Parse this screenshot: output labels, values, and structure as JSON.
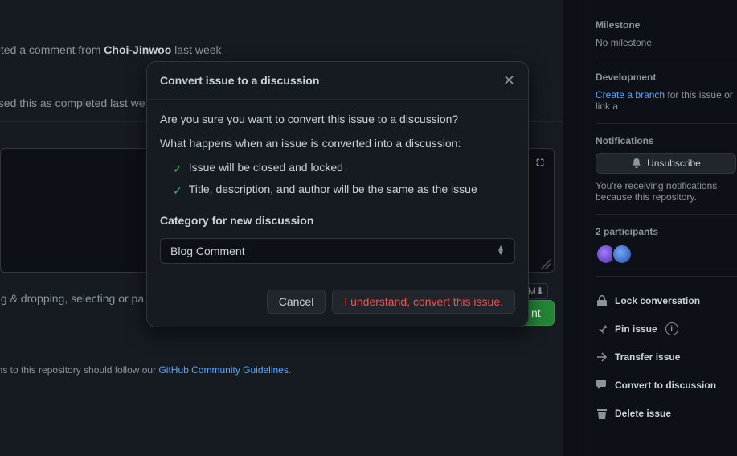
{
  "timeline": {
    "evt1_prefix": "leted a comment from ",
    "evt1_user": "Choi-Jinwoo",
    "evt1_suffix": " last week",
    "evt2": "osed this as completed last we"
  },
  "composer": {
    "dragdrop": "ing & dropping, selecting or pa",
    "comment_btn": "nt",
    "guidelines_prefix": "ons to this repository should follow our ",
    "guidelines_link": "GitHub Community Guidelines",
    "guidelines_suffix": "."
  },
  "sidebar": {
    "milestone_heading": "Milestone",
    "milestone_value": "No milestone",
    "development_heading": "Development",
    "create_branch": "Create a branch",
    "dev_suffix": " for this issue or link a",
    "notifications_heading": "Notifications",
    "unsubscribe": "Unsubscribe",
    "notif_text": "You're receiving notifications because this repository.",
    "participants_label": "2 participants",
    "actions": {
      "lock": "Lock conversation",
      "pin": "Pin issue",
      "transfer": "Transfer issue",
      "convert": "Convert to discussion",
      "delete": "Delete issue"
    }
  },
  "modal": {
    "title": "Convert issue to a discussion",
    "confirm_q": "Are you sure you want to convert this issue to a discussion?",
    "what_happens": "What happens when an issue is converted into a discussion:",
    "bullet1": "Issue will be closed and locked",
    "bullet2": "Title, description, and author will be the same as the issue",
    "category_label": "Category for new discussion",
    "category_value": "Blog Comment",
    "cancel": "Cancel",
    "submit": "I understand, convert this issue."
  }
}
